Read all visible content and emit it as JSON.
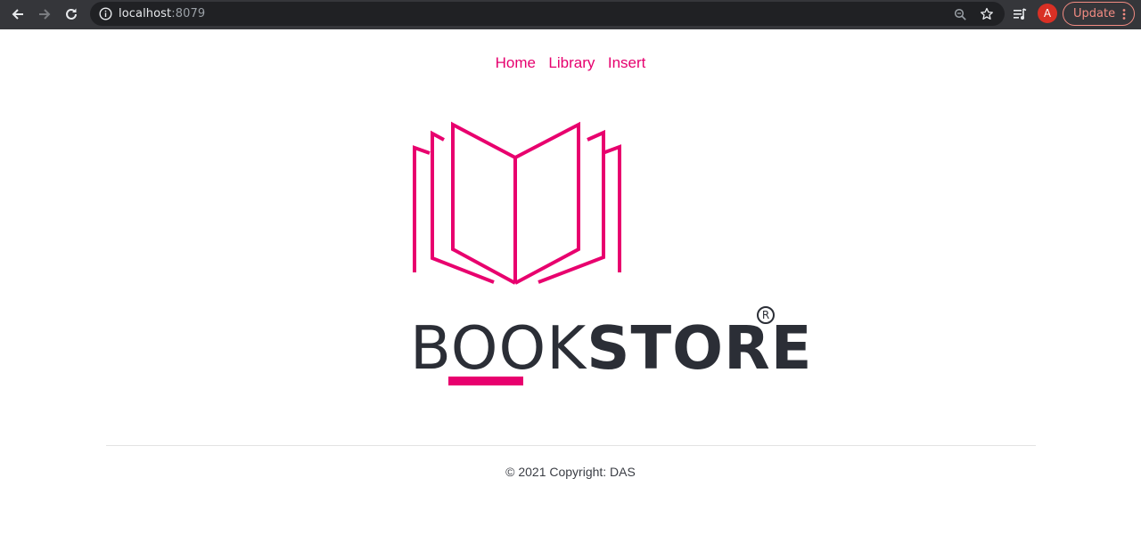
{
  "browser": {
    "url_host": "localhost",
    "url_port": ":8079",
    "avatar_initial": "A",
    "update_label": "Update",
    "icons": [
      "back-arrow-icon",
      "forward-arrow-icon",
      "reload-icon",
      "info-icon",
      "zoom-icon",
      "star-icon",
      "media-queue-icon",
      "more-vert-icon"
    ]
  },
  "nav": {
    "items": [
      {
        "label": "Home"
      },
      {
        "label": "Library"
      },
      {
        "label": "Insert"
      }
    ]
  },
  "logo": {
    "brand_light": "BOOK",
    "brand_bold": "STORE",
    "registered": "R",
    "accent_color": "#e8006e",
    "text_color": "#2b2e36"
  },
  "footer": {
    "copyright": "© 2021 Copyright: DAS"
  }
}
